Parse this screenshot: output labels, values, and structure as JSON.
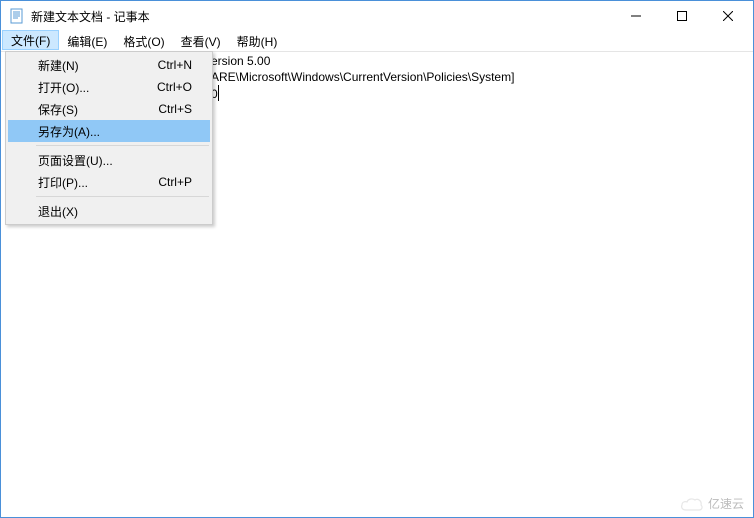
{
  "title": "新建文本文档 - 记事本",
  "menubar": {
    "items": [
      "文件(F)",
      "编辑(E)",
      "格式(O)",
      "查看(V)",
      "帮助(H)"
    ]
  },
  "file_menu": {
    "items": [
      {
        "label": "新建(N)",
        "shortcut": "Ctrl+N"
      },
      {
        "label": "打开(O)...",
        "shortcut": "Ctrl+O"
      },
      {
        "label": "保存(S)",
        "shortcut": "Ctrl+S"
      },
      {
        "label": "另存为(A)...",
        "shortcut": ""
      },
      {
        "sep": true
      },
      {
        "label": "页面设置(U)...",
        "shortcut": ""
      },
      {
        "label": "打印(P)...",
        "shortcut": "Ctrl+P"
      },
      {
        "sep": true
      },
      {
        "label": "退出(X)",
        "shortcut": ""
      }
    ],
    "highlighted_index": 3
  },
  "content": {
    "line1_partial": "ersion 5.00",
    "line2_partial": "ARE\\Microsoft\\Windows\\CurrentVersion\\Policies\\System]",
    "line3_partial": "0"
  },
  "watermark": {
    "text": "亿速云"
  }
}
